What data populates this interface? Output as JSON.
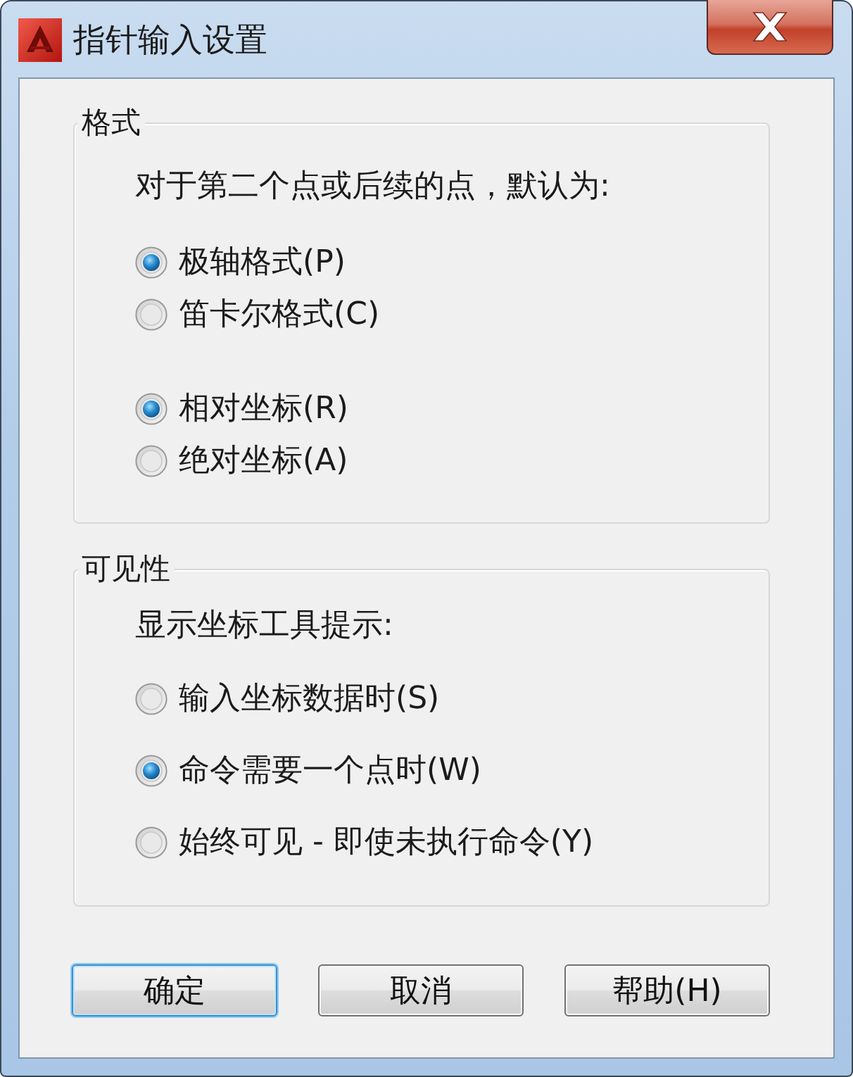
{
  "window": {
    "title": "指针输入设置"
  },
  "groups": [
    {
      "title": "格式",
      "prompt": "对于第二个点或后续的点，默认为:",
      "radio_sets": [
        [
          {
            "label": "极轴格式(P)",
            "selected": true
          },
          {
            "label": "笛卡尔格式(C)",
            "selected": false
          }
        ],
        [
          {
            "label": "相对坐标(R)",
            "selected": true
          },
          {
            "label": "绝对坐标(A)",
            "selected": false
          }
        ]
      ]
    },
    {
      "title": "可见性",
      "prompt": "显示坐标工具提示:",
      "radio_sets": [
        [
          {
            "label": "输入坐标数据时(S)",
            "selected": false
          },
          {
            "label": "命令需要一个点时(W)",
            "selected": true
          },
          {
            "label": "始终可见 - 即使未执行命令(Y)",
            "selected": false
          }
        ]
      ]
    }
  ],
  "buttons": [
    {
      "label": "确定",
      "default": true
    },
    {
      "label": "取消",
      "default": false
    },
    {
      "label": "帮助(H)",
      "default": false
    }
  ]
}
